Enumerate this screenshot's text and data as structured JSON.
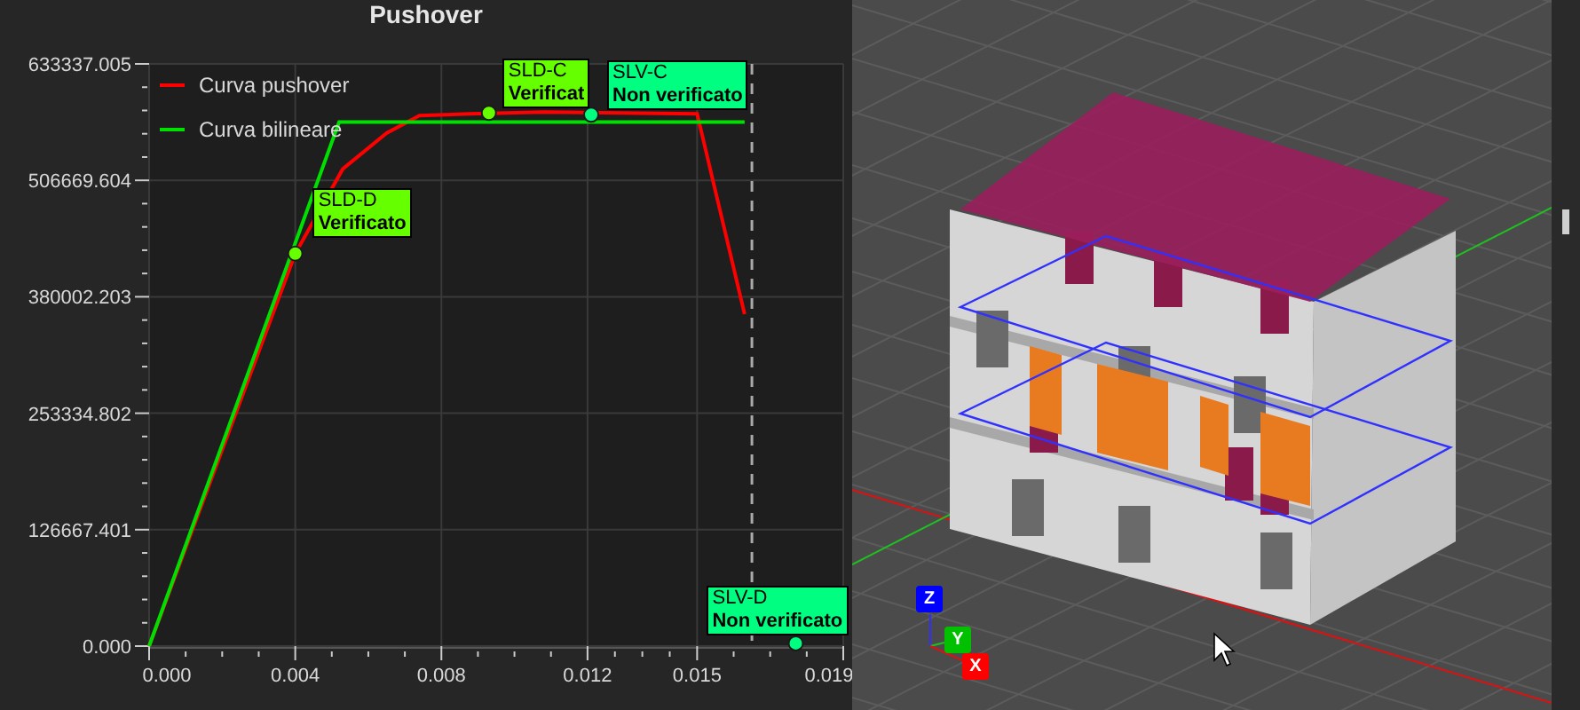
{
  "chart_panel": {
    "limit_states": [
      {
        "status": "Verificato",
        "verified": true
      },
      {
        "status": "Verificat",
        "verified": true
      },
      {
        "status": "Non verificato",
        "verified": false
      },
      {
        "status": "Non verificato",
        "verified": false
      }
    ],
    "chart_data": {
      "type": "line",
      "title": "Pushover",
      "xlim": [
        0,
        0.019
      ],
      "ylim": [
        0,
        633337.005
      ],
      "grid": true,
      "legend": true,
      "xticks": [
        {
          "value": 0,
          "label": "0.000"
        },
        {
          "value": 0.004,
          "label": "0.004"
        },
        {
          "value": 0.008,
          "label": "0.008"
        },
        {
          "value": 0.012,
          "label": "0.012"
        },
        {
          "value": 0.015,
          "label": "0.015"
        },
        {
          "value": 0.019,
          "label": "0.019"
        }
      ],
      "yticks": [
        {
          "value": 0,
          "label": "0.000"
        },
        {
          "value": 126667.401,
          "label": "126667.401"
        },
        {
          "value": 253334.802,
          "label": "253334.802"
        },
        {
          "value": 380002.203,
          "label": "380002.203"
        },
        {
          "value": 506669.604,
          "label": "506669.604"
        },
        {
          "value": 633337.005,
          "label": "633337.005"
        }
      ],
      "series": [
        {
          "name": "Curva pushover",
          "color": "#ff0000",
          "x": [
            0,
            0.004,
            0.0053,
            0.0065,
            0.0074,
            0.0088,
            0.0108,
            0.015,
            0.0163
          ],
          "values": [
            0,
            427000,
            519000,
            558000,
            577000,
            579000,
            581000,
            579000,
            361000
          ]
        },
        {
          "name": "Curva bilineare",
          "color": "#00e000",
          "x": [
            0,
            0.0052,
            0.0163
          ],
          "values": [
            0,
            570000,
            570000
          ]
        }
      ],
      "ref_lines": [
        {
          "axis": "x",
          "value": 0.0165
        }
      ],
      "annotations": [
        {
          "text": "SLD-D",
          "x": 0.004,
          "y": 427000
        },
        {
          "text": "SLD-C",
          "x": 0.0093,
          "y": 580000
        },
        {
          "text": "SLV-C",
          "x": 0.0121,
          "y": 578000
        },
        {
          "text": "SLV-D",
          "x": 0.0177,
          "y": 3000
        }
      ]
    }
  },
  "viewport": {
    "gizmo": [
      {
        "label": "Z",
        "color": "#0000ff"
      },
      {
        "label": "Y",
        "color": "#00c000"
      },
      {
        "label": "X",
        "color": "#ff0000"
      }
    ]
  }
}
